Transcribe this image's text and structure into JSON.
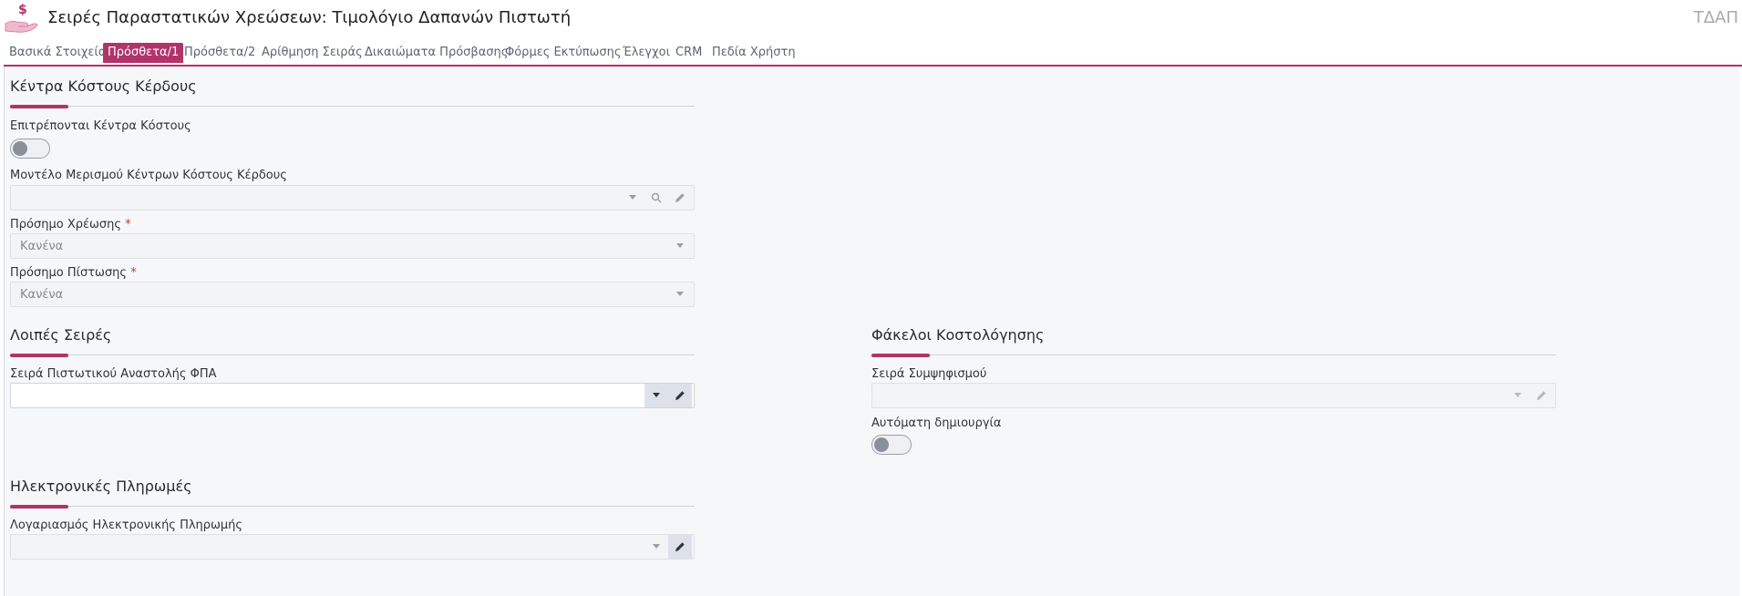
{
  "header": {
    "title": "Σειρές Παραστατικών Χρεώσεων: Τιμολόγιο Δαπανών Πιστωτή",
    "abbr": "ΤΔΑΠ"
  },
  "tabs": [
    {
      "label": "Βασικά Στοιχεία"
    },
    {
      "label": "Πρόσθετα/1",
      "active": true
    },
    {
      "label": "Πρόσθετα/2"
    },
    {
      "label": "Αρίθμηση Σειράς"
    },
    {
      "label": "Δικαιώματα Πρόσβασης"
    },
    {
      "label": "Φόρμες Εκτύπωσης"
    },
    {
      "label": "Έλεγχοι"
    },
    {
      "label": "CRM"
    },
    {
      "label": "Πεδία Χρήστη"
    }
  ],
  "cost_centers": {
    "title": "Κέντρα Κόστους Κέρδους",
    "allow_label": "Επιτρέπονται Κέντρα Κόστους",
    "allow_value": false,
    "model_label": "Μοντέλο Μερισμού Κέντρων Κόστους Κέρδους",
    "model_value": "",
    "debit_sign_label": "Πρόσημο Χρέωσης",
    "debit_sign_value": "Κανένα",
    "credit_sign_label": "Πρόσημο Πίστωσης",
    "credit_sign_value": "Κανένα",
    "required_mark": "*"
  },
  "other_series": {
    "title": "Λοιπές Σειρές",
    "vat_credit_label": "Σειρά Πιστωτικού Αναστολής ΦΠΑ",
    "vat_credit_value": ""
  },
  "costing": {
    "title": "Φάκελοι Κοστολόγησης",
    "offset_label": "Σειρά Συμψηφισμού",
    "offset_value": "",
    "auto_label": "Αυτόματη δημιουργία",
    "auto_value": false
  },
  "epay": {
    "title": "Ηλεκτρονικές Πληρωμές",
    "account_label": "Λογαριασμός Ηλεκτρονικής Πληρωμής",
    "account_value": ""
  },
  "colors": {
    "accent": "#b0346a",
    "panel": "#f6f7f9"
  }
}
